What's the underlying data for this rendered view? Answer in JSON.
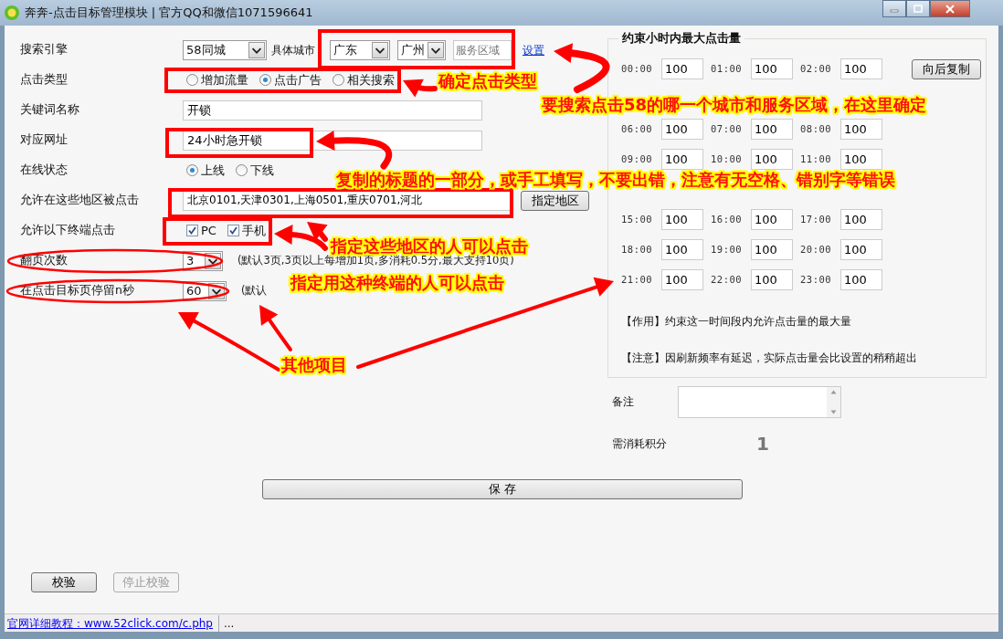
{
  "window": {
    "title": "奔奔-点击目标管理模块 | 官方QQ和微信1071596641"
  },
  "form": {
    "engine": {
      "label": "搜索引擎",
      "value": "58同城",
      "city_label": "具体城市",
      "province": "广东",
      "city": "广州",
      "area_placeholder": "服务区域",
      "link": "设置"
    },
    "click_type": {
      "label": "点击类型",
      "options": [
        {
          "label": "增加流量",
          "selected": false
        },
        {
          "label": "点击广告",
          "selected": true
        },
        {
          "label": "相关搜索",
          "selected": false
        }
      ]
    },
    "keyword": {
      "label": "关键词名称",
      "value": "开锁"
    },
    "url": {
      "label": "对应网址",
      "value": "24小时急开锁"
    },
    "online": {
      "label": "在线状态",
      "options": [
        {
          "label": "上线",
          "selected": true
        },
        {
          "label": "下线",
          "selected": false
        }
      ]
    },
    "regions": {
      "label": "允许在这些地区被点击",
      "value": "北京0101,天津0301,上海0501,重庆0701,河北",
      "button": "指定地区"
    },
    "terminals": {
      "label": "允许以下终端点击",
      "options": [
        {
          "label": "PC",
          "checked": true
        },
        {
          "label": "手机",
          "checked": true
        }
      ]
    },
    "pages": {
      "label": "翻页次数",
      "value": "3",
      "hint": "(默认3页,3页以上每增加1页,多消耗0.5分,最大支持10页)"
    },
    "stay": {
      "label": "在点击目标页停留n秒",
      "value": "60",
      "hint": "(默认"
    }
  },
  "limits": {
    "title": "约束小时内最大点击量",
    "copy_button": "向后复制",
    "rows": [
      {
        "cells": [
          {
            "time": "00:00",
            "value": "100"
          },
          {
            "time": "01:00",
            "value": "100"
          },
          {
            "time": "02:00",
            "value": "100"
          }
        ]
      },
      {
        "cells": [
          {
            "time": "06:00",
            "value": "100"
          },
          {
            "time": "07:00",
            "value": "100"
          },
          {
            "time": "08:00",
            "value": "100"
          }
        ]
      },
      {
        "cells": [
          {
            "time": "09:00",
            "value": "100"
          },
          {
            "time": "10:00",
            "value": "100"
          },
          {
            "time": "11:00",
            "value": "100"
          }
        ]
      },
      {
        "cells": [
          {
            "time": "15:00",
            "value": "100"
          },
          {
            "time": "16:00",
            "value": "100"
          },
          {
            "time": "17:00",
            "value": "100"
          }
        ]
      },
      {
        "cells": [
          {
            "time": "18:00",
            "value": "100"
          },
          {
            "time": "19:00",
            "value": "100"
          },
          {
            "time": "20:00",
            "value": "100"
          }
        ]
      },
      {
        "cells": [
          {
            "time": "21:00",
            "value": "100"
          },
          {
            "time": "22:00",
            "value": "100"
          },
          {
            "time": "23:00",
            "value": "100"
          }
        ]
      }
    ],
    "notes": [
      "【作用】约束这一时间段内允许点击量的最大量",
      "【注意】因刷新频率有延迟，实际点击量会比设置的稍稍超出"
    ]
  },
  "remark": {
    "label": "备注"
  },
  "cost": {
    "label": "需消耗积分",
    "value": "1"
  },
  "buttons": {
    "save": "保 存",
    "verify": {
      "label": "校验",
      "disabled": false
    },
    "stop": {
      "label": "停止校验",
      "disabled": true
    }
  },
  "status_bar": {
    "link": "官网详细教程：www.52click.com/c.php",
    "extra": "..."
  },
  "annotations": {
    "callouts": [
      "要搜索点击58的哪一个城市和服务区域，在这里确定",
      "确定点击类型",
      "复制的标题的一部分，或手工填写，不要出错，注意有无空格、错别字等错误",
      "指定这些地区的人可以点击",
      "指定用这种终端的人可以点击",
      "其他项目"
    ]
  }
}
